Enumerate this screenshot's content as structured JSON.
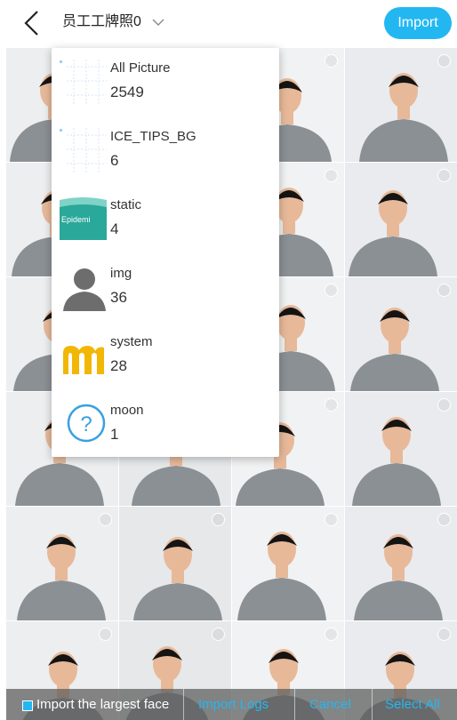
{
  "header": {
    "album_title": "员工工牌照0",
    "import_label": "Import"
  },
  "dropdown": {
    "items": [
      {
        "name": "All Picture",
        "count": "2549",
        "thumb": "grid-thumb-icon"
      },
      {
        "name": "ICE_TIPS_BG",
        "count": "6",
        "thumb": "grid-thumb-icon"
      },
      {
        "name": "static",
        "count": "4",
        "thumb": "epidemic-thumb",
        "thumb_text": "Epidemi"
      },
      {
        "name": "img",
        "count": "36",
        "thumb": "person-silhouette-icon"
      },
      {
        "name": "system",
        "count": "28",
        "thumb": "m-logo-icon"
      },
      {
        "name": "moon",
        "count": "1",
        "thumb": "question-circle-icon",
        "thumb_text": "?"
      }
    ]
  },
  "bottom_bar": {
    "largest_face_label": "Import the largest face",
    "import_logs_label": "Import Logs",
    "cancel_label": "Cancel",
    "select_all_label": "Select All"
  },
  "colors": {
    "accent": "#23b7f2",
    "shirt": "#8b9094",
    "skin": "#e7b999",
    "hair": "#141414"
  }
}
